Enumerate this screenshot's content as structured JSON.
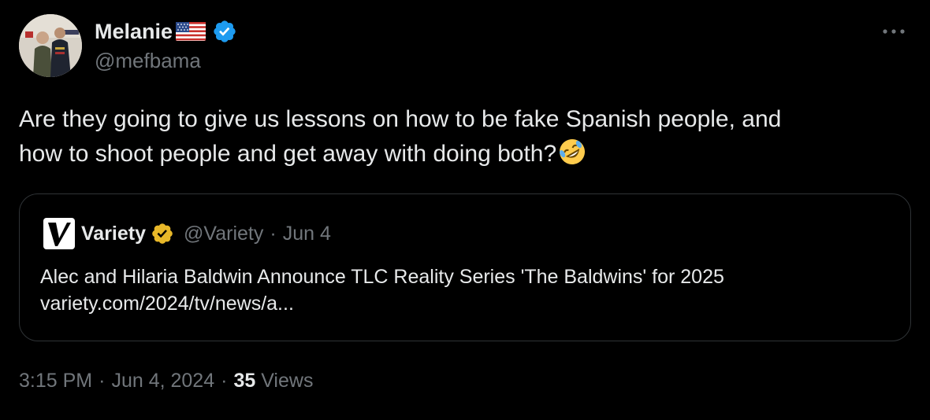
{
  "author": {
    "display_name": "Melanie",
    "flag_icon": "us-flag-icon",
    "verified_icon": "blue-verified-badge-icon",
    "verified_color": "#1d9bf0",
    "handle": "@mefbama",
    "more_icon": "more-options-icon"
  },
  "tweet": {
    "line1": "Are they going to give us lessons on how to be fake Spanish people, and",
    "line2": "how to shoot people and get away with doing both?",
    "emoji": "rolling-on-floor-laughing-emoji"
  },
  "quoted_tweet": {
    "author_name": "Variety",
    "logo_letter": "V",
    "verified_icon": "gold-verified-badge-icon",
    "verified_color": "#e8b829",
    "handle": "@Variety",
    "separator": "·",
    "date": "Jun 4",
    "text_line1": "Alec and Hilaria Baldwin Announce TLC Reality Series 'The Baldwins' for 2025",
    "text_line2": "variety.com/2024/tv/news/a..."
  },
  "meta": {
    "time": "3:15 PM",
    "separator": "·",
    "date": "Jun 4, 2024",
    "views_count": "35",
    "views_label": "Views"
  },
  "colors": {
    "background": "#000000",
    "primary_text": "#e7e9ea",
    "secondary_text": "#71767b",
    "border": "#2f3336"
  }
}
